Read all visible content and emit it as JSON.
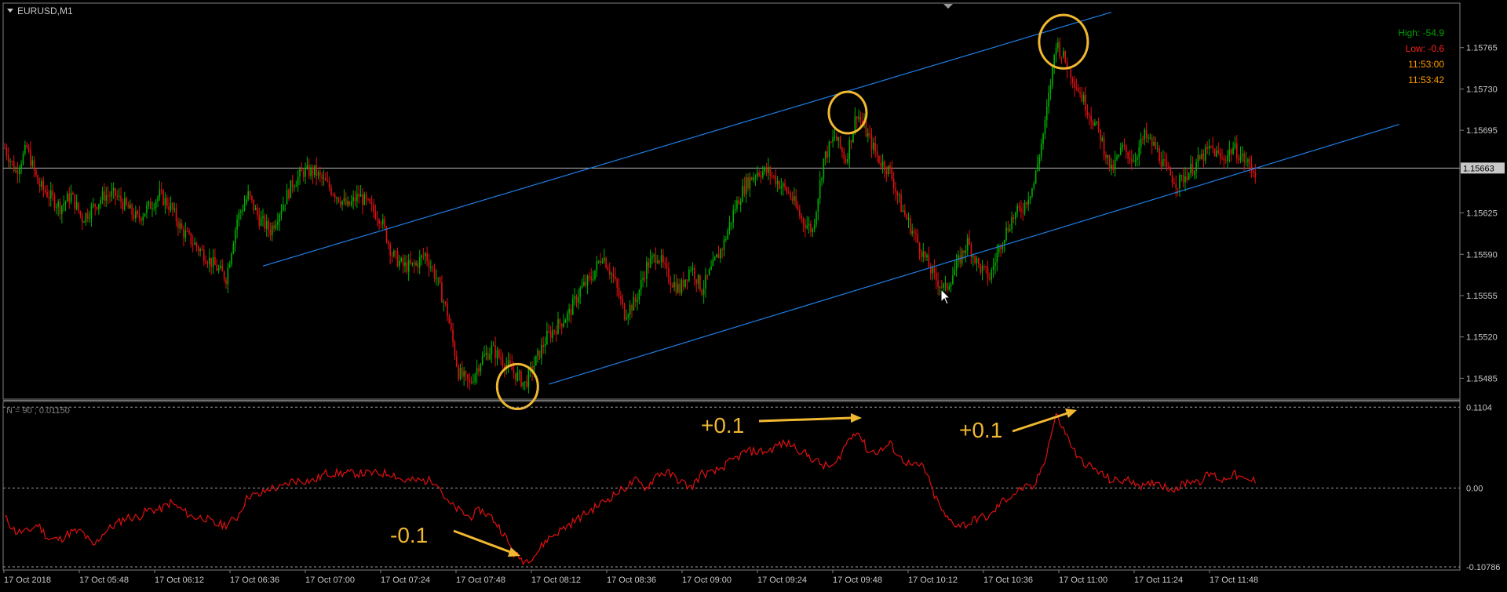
{
  "window": {
    "symbol_label": "EURUSD,M1"
  },
  "info_panel": {
    "high": "High: -54.9",
    "low": "Low: -0.6",
    "time_bar": "11:53:00",
    "time_server": "11:53:42"
  },
  "indicator": {
    "label": "N = 90 ; 0.01150"
  },
  "annotations": {
    "plus_1": "+0.1",
    "plus_2": "+0.1",
    "minus_1": "-0.1"
  },
  "colors": {
    "background": "#000000",
    "grid_frame": "#7f7f7f",
    "bull": "#00b000",
    "bear": "#e01010",
    "channel": "#1e7ee6",
    "marker": "#f0b830",
    "indicator_line": "#e01010",
    "high_text": "#00a000",
    "low_text": "#ff2020",
    "time_text": "#ff9a00"
  },
  "chart_data": [
    {
      "type": "candlestick",
      "symbol": "EURUSD",
      "timeframe": "M1",
      "ylim": [
        1.1547,
        1.158
      ],
      "y_ticks": [
        "1.15765",
        "1.15730",
        "1.15695",
        "1.15663",
        "1.15625",
        "1.15590",
        "1.15555",
        "1.15520",
        "1.15485"
      ],
      "current_price": "1.15663",
      "x_ticks": [
        "17 Oct 2018",
        "17 Oct 05:48",
        "17 Oct 06:12",
        "17 Oct 06:36",
        "17 Oct 07:00",
        "17 Oct 07:24",
        "17 Oct 07:48",
        "17 Oct 08:12",
        "17 Oct 08:36",
        "17 Oct 09:00",
        "17 Oct 09:24",
        "17 Oct 09:48",
        "17 Oct 10:12",
        "17 Oct 10:36",
        "17 Oct 11:00",
        "17 Oct 11:24",
        "17 Oct 11:48"
      ],
      "close_series": [
        [
          0,
          1.1568
        ],
        [
          6,
          1.1566
        ],
        [
          12,
          1.1568
        ],
        [
          18,
          1.1565
        ],
        [
          24,
          1.1564
        ],
        [
          30,
          1.1563
        ],
        [
          36,
          1.1564
        ],
        [
          42,
          1.1562
        ],
        [
          48,
          1.1563
        ],
        [
          54,
          1.1564
        ],
        [
          60,
          1.1564
        ],
        [
          66,
          1.1563
        ],
        [
          72,
          1.1562
        ],
        [
          78,
          1.1563
        ],
        [
          84,
          1.1564
        ],
        [
          90,
          1.1563
        ],
        [
          96,
          1.1561
        ],
        [
          102,
          1.156
        ],
        [
          108,
          1.1559
        ],
        [
          114,
          1.1558
        ],
        [
          120,
          1.1557
        ],
        [
          126,
          1.1562
        ],
        [
          132,
          1.1564
        ],
        [
          138,
          1.1562
        ],
        [
          144,
          1.1561
        ],
        [
          150,
          1.1563
        ],
        [
          156,
          1.1565
        ],
        [
          162,
          1.1566
        ],
        [
          168,
          1.1566
        ],
        [
          174,
          1.1565
        ],
        [
          180,
          1.1564
        ],
        [
          186,
          1.1563
        ],
        [
          192,
          1.1564
        ],
        [
          198,
          1.1563
        ],
        [
          204,
          1.1562
        ],
        [
          210,
          1.1559
        ],
        [
          216,
          1.1558
        ],
        [
          222,
          1.1558
        ],
        [
          228,
          1.1559
        ],
        [
          234,
          1.1557
        ],
        [
          240,
          1.1554
        ],
        [
          246,
          1.1549
        ],
        [
          252,
          1.1548
        ],
        [
          258,
          1.155
        ],
        [
          264,
          1.1551
        ],
        [
          270,
          1.155
        ],
        [
          276,
          1.1549
        ],
        [
          282,
          1.1548
        ],
        [
          288,
          1.155
        ],
        [
          294,
          1.1552
        ],
        [
          300,
          1.1553
        ],
        [
          306,
          1.1554
        ],
        [
          312,
          1.1556
        ],
        [
          318,
          1.1557
        ],
        [
          324,
          1.1559
        ],
        [
          330,
          1.1557
        ],
        [
          336,
          1.1554
        ],
        [
          342,
          1.1555
        ],
        [
          348,
          1.1558
        ],
        [
          354,
          1.1559
        ],
        [
          360,
          1.1557
        ],
        [
          366,
          1.1556
        ],
        [
          372,
          1.1558
        ],
        [
          378,
          1.1556
        ],
        [
          384,
          1.1558
        ],
        [
          390,
          1.156
        ],
        [
          396,
          1.1563
        ],
        [
          402,
          1.1565
        ],
        [
          408,
          1.1566
        ],
        [
          414,
          1.1566
        ],
        [
          420,
          1.1565
        ],
        [
          426,
          1.1564
        ],
        [
          432,
          1.1562
        ],
        [
          438,
          1.1561
        ],
        [
          444,
          1.1567
        ],
        [
          450,
          1.1569
        ],
        [
          456,
          1.1567
        ],
        [
          462,
          1.1571
        ],
        [
          468,
          1.1569
        ],
        [
          474,
          1.1567
        ],
        [
          480,
          1.1566
        ],
        [
          486,
          1.1563
        ],
        [
          492,
          1.1561
        ],
        [
          498,
          1.1559
        ],
        [
          504,
          1.1557
        ],
        [
          510,
          1.1556
        ],
        [
          516,
          1.1558
        ],
        [
          522,
          1.156
        ],
        [
          528,
          1.1558
        ],
        [
          534,
          1.1557
        ],
        [
          540,
          1.156
        ],
        [
          546,
          1.1562
        ],
        [
          552,
          1.1563
        ],
        [
          558,
          1.1565
        ],
        [
          564,
          1.157
        ],
        [
          570,
          1.1577
        ],
        [
          576,
          1.1575
        ],
        [
          582,
          1.1573
        ],
        [
          588,
          1.1571
        ],
        [
          594,
          1.1569
        ],
        [
          600,
          1.1566
        ],
        [
          606,
          1.1568
        ],
        [
          612,
          1.1567
        ],
        [
          618,
          1.1569
        ],
        [
          624,
          1.1568
        ],
        [
          630,
          1.1566
        ],
        [
          636,
          1.1565
        ],
        [
          642,
          1.1566
        ],
        [
          648,
          1.1567
        ],
        [
          654,
          1.1568
        ],
        [
          660,
          1.1567
        ],
        [
          666,
          1.1568
        ],
        [
          672,
          1.1567
        ],
        [
          678,
          1.1566
        ]
      ],
      "channel_lines": [
        {
          "name": "upper",
          "points": [
            [
              140,
              1.1558
            ],
            [
              600,
              1.15795
            ]
          ]
        },
        {
          "name": "lower",
          "points": [
            [
              295,
              1.1548
            ],
            [
              756,
              1.157
            ]
          ]
        }
      ],
      "highlighted_points": [
        {
          "x": 278,
          "price": 1.15478
        },
        {
          "x": 457,
          "price": 1.1571
        },
        {
          "x": 574,
          "price": 1.1577
        }
      ]
    },
    {
      "type": "line",
      "name": "N = 90 ; 0.01150",
      "ylim": [
        -0.11,
        0.115
      ],
      "y_ticks": [
        "0.1104",
        "0.00",
        "-0.10786"
      ],
      "reference_levels": [
        0.1104,
        0.0,
        -0.10786
      ],
      "values": [
        [
          0,
          -0.04
        ],
        [
          6,
          -0.06
        ],
        [
          12,
          -0.06
        ],
        [
          18,
          -0.05
        ],
        [
          24,
          -0.07
        ],
        [
          30,
          -0.07
        ],
        [
          36,
          -0.06
        ],
        [
          42,
          -0.06
        ],
        [
          48,
          -0.08
        ],
        [
          54,
          -0.06
        ],
        [
          60,
          -0.05
        ],
        [
          66,
          -0.04
        ],
        [
          72,
          -0.04
        ],
        [
          78,
          -0.03
        ],
        [
          84,
          -0.03
        ],
        [
          90,
          -0.02
        ],
        [
          96,
          -0.03
        ],
        [
          102,
          -0.04
        ],
        [
          108,
          -0.04
        ],
        [
          114,
          -0.05
        ],
        [
          120,
          -0.05
        ],
        [
          126,
          -0.04
        ],
        [
          132,
          -0.01
        ],
        [
          138,
          -0.01
        ],
        [
          144,
          0.0
        ],
        [
          150,
          0.0
        ],
        [
          156,
          0.01
        ],
        [
          162,
          0.01
        ],
        [
          168,
          0.01
        ],
        [
          174,
          0.02
        ],
        [
          180,
          0.02
        ],
        [
          186,
          0.02
        ],
        [
          192,
          0.02
        ],
        [
          198,
          0.02
        ],
        [
          204,
          0.02
        ],
        [
          210,
          0.02
        ],
        [
          216,
          0.01
        ],
        [
          222,
          0.01
        ],
        [
          228,
          0.01
        ],
        [
          234,
          0.01
        ],
        [
          240,
          -0.02
        ],
        [
          246,
          -0.03
        ],
        [
          252,
          -0.04
        ],
        [
          258,
          -0.03
        ],
        [
          264,
          -0.04
        ],
        [
          270,
          -0.06
        ],
        [
          276,
          -0.09
        ],
        [
          282,
          -0.1
        ],
        [
          288,
          -0.09
        ],
        [
          294,
          -0.07
        ],
        [
          300,
          -0.06
        ],
        [
          306,
          -0.05
        ],
        [
          312,
          -0.04
        ],
        [
          318,
          -0.03
        ],
        [
          324,
          -0.02
        ],
        [
          330,
          -0.01
        ],
        [
          336,
          0.0
        ],
        [
          342,
          0.01
        ],
        [
          348,
          0.0
        ],
        [
          354,
          0.02
        ],
        [
          360,
          0.02
        ],
        [
          366,
          0.01
        ],
        [
          372,
          0.0
        ],
        [
          378,
          0.02
        ],
        [
          384,
          0.02
        ],
        [
          390,
          0.03
        ],
        [
          396,
          0.04
        ],
        [
          402,
          0.05
        ],
        [
          408,
          0.05
        ],
        [
          414,
          0.05
        ],
        [
          420,
          0.06
        ],
        [
          426,
          0.06
        ],
        [
          432,
          0.05
        ],
        [
          438,
          0.04
        ],
        [
          444,
          0.03
        ],
        [
          450,
          0.03
        ],
        [
          456,
          0.06
        ],
        [
          462,
          0.08
        ],
        [
          468,
          0.05
        ],
        [
          474,
          0.05
        ],
        [
          480,
          0.06
        ],
        [
          486,
          0.04
        ],
        [
          492,
          0.03
        ],
        [
          498,
          0.03
        ],
        [
          504,
          -0.01
        ],
        [
          510,
          -0.04
        ],
        [
          516,
          -0.05
        ],
        [
          522,
          -0.05
        ],
        [
          528,
          -0.04
        ],
        [
          534,
          -0.04
        ],
        [
          540,
          -0.02
        ],
        [
          546,
          -0.01
        ],
        [
          552,
          0.0
        ],
        [
          558,
          0.0
        ],
        [
          564,
          0.04
        ],
        [
          570,
          0.1
        ],
        [
          576,
          0.07
        ],
        [
          582,
          0.04
        ],
        [
          588,
          0.03
        ],
        [
          594,
          0.02
        ],
        [
          600,
          0.01
        ],
        [
          606,
          0.01
        ],
        [
          612,
          0.01
        ],
        [
          618,
          0.0
        ],
        [
          624,
          0.01
        ],
        [
          630,
          0.0
        ],
        [
          636,
          0.0
        ],
        [
          642,
          0.01
        ],
        [
          648,
          0.01
        ],
        [
          654,
          0.02
        ],
        [
          660,
          0.01
        ],
        [
          666,
          0.02
        ],
        [
          672,
          0.01
        ],
        [
          678,
          0.01
        ]
      ]
    }
  ]
}
